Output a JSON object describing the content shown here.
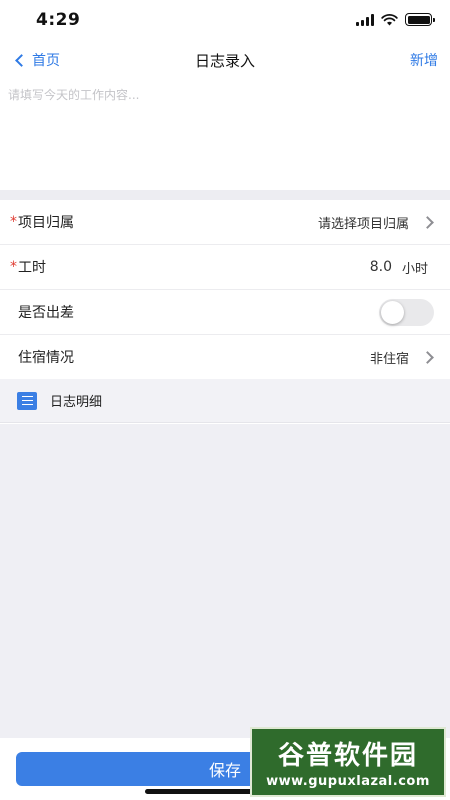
{
  "status_bar": {
    "time": "4:29"
  },
  "nav": {
    "back_label": "首页",
    "title": "日志录入",
    "action_label": "新增"
  },
  "content": {
    "placeholder": "请填写今天的工作内容..."
  },
  "form": {
    "project": {
      "required_mark": "*",
      "label": "项目归属",
      "value": "请选择项目归属"
    },
    "hours": {
      "required_mark": "*",
      "label": "工时",
      "value": "8.0",
      "unit": "小时"
    },
    "business_trip": {
      "label": "是否出差",
      "enabled": false
    },
    "lodging": {
      "label": "住宿情况",
      "value": "非住宿"
    }
  },
  "section": {
    "title": "日志明细"
  },
  "footer": {
    "save_label": "保存"
  },
  "watermark": {
    "title": "谷普软件园",
    "url": "www.gupuxlazal.com"
  },
  "colors": {
    "accent": "#3b7fe4",
    "required": "#e03c32",
    "background_gray": "#efeff4"
  }
}
